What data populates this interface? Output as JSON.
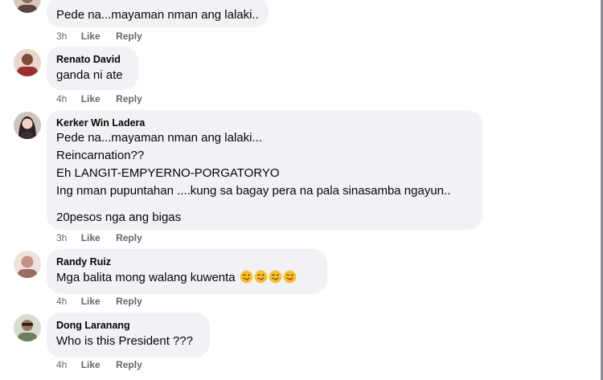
{
  "comments": [
    {
      "author": "",
      "lines": [
        "Pede na...mayaman nman ang lalaki.."
      ],
      "time": "3h",
      "like_label": "Like",
      "reply_label": "Reply",
      "avatar_color": "#8a6a5e"
    },
    {
      "author": "Renato David",
      "lines": [
        "ganda ni ate"
      ],
      "time": "4h",
      "like_label": "Like",
      "reply_label": "Reply",
      "avatar_color": "#9b2e2e"
    },
    {
      "author": "Kerker Win Ladera",
      "lines": [
        "Pede na...mayaman nman ang lalaki...",
        "Reincarnation??",
        "Eh LANGIT-EMPYERNO-PORGATORYO",
        "Ing nman pupuntahan ....kung sa bagay pera na pala sinasamba ngayun..",
        "20pesos nga ang bigas"
      ],
      "time": "3h",
      "like_label": "Like",
      "reply_label": "Reply",
      "avatar_color": "#3b2f2f"
    },
    {
      "author": "Randy Ruiz",
      "lines": [
        "Mga balita mong walang kuwenta"
      ],
      "emoji": [
        "winking-tongue-emoji",
        "winking-tongue-emoji",
        "winking-tongue-emoji",
        "winking-tongue-emoji"
      ],
      "time": "4h",
      "like_label": "Like",
      "reply_label": "Reply",
      "avatar_color": "#c98f86"
    },
    {
      "author": "Dong Laranang",
      "lines": [
        "Who is this President ???"
      ],
      "time": "4h",
      "like_label": "Like",
      "reply_label": "Reply",
      "avatar_color": "#6b7f5a"
    }
  ],
  "colors": {
    "bubble_bg": "#f0f2f5",
    "meta_text": "#65676b",
    "emoji_face": "#f7c02c",
    "emoji_tongue": "#e0245e"
  }
}
